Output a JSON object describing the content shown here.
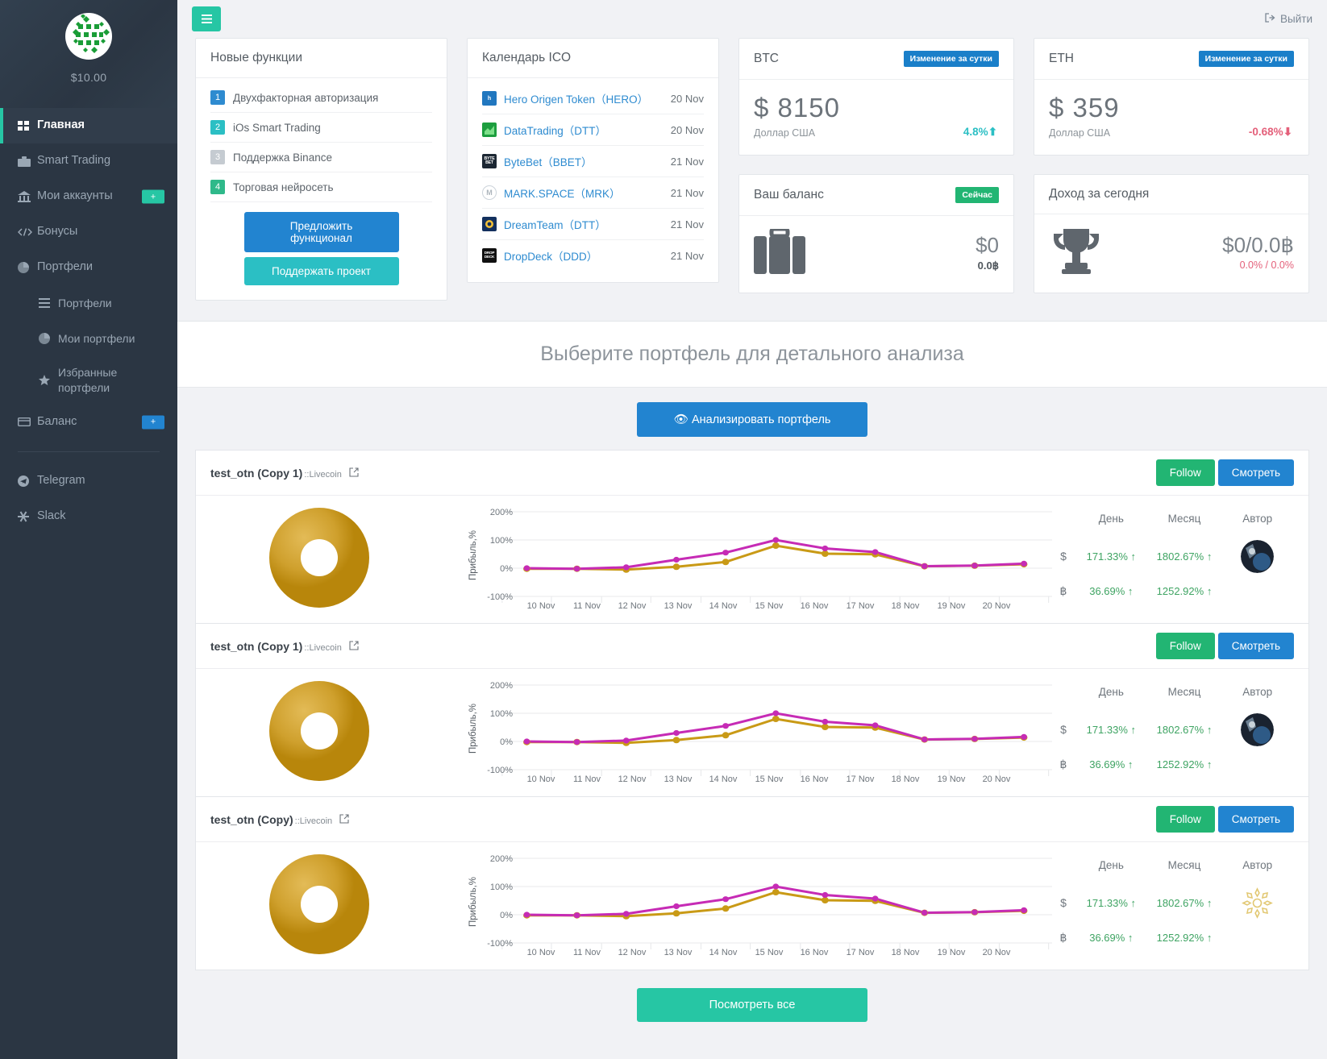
{
  "sidebar": {
    "balance": "$10.00",
    "logo_icon": "globe-grid-icon",
    "items": [
      {
        "label": "Главная",
        "icon": "dashboard-icon",
        "active": true
      },
      {
        "label": "Smart Trading",
        "icon": "briefcase-icon",
        "active": false
      },
      {
        "label": "Мои аккаунты",
        "icon": "bank-icon",
        "badge": "+",
        "badge_color": "#26c6a4"
      },
      {
        "label": "Бонусы",
        "icon": "code-icon"
      },
      {
        "label": "Портфели",
        "icon": "pie-chart-icon"
      }
    ],
    "sub_items": [
      {
        "label": "Портфели",
        "icon": "list-icon"
      },
      {
        "label": "Мои портфели",
        "icon": "pie-chart-icon"
      },
      {
        "label": "Избранные портфели",
        "icon": "star-icon"
      }
    ],
    "balance_item": {
      "label": "Баланс",
      "icon": "card-icon",
      "badge": "+",
      "badge_color": "#2284d0"
    },
    "social": [
      {
        "label": "Telegram",
        "icon": "telegram-icon"
      },
      {
        "label": "Slack",
        "icon": "slack-icon"
      }
    ]
  },
  "topbar": {
    "menu_icon": "hamburger-icon",
    "logout_label": "Выйти",
    "logout_icon": "logout-icon"
  },
  "features_card": {
    "title": "Новые функции",
    "items": [
      {
        "num": "1",
        "label": "Двухфакторная авторизация"
      },
      {
        "num": "2",
        "label": "iOs Smart Trading"
      },
      {
        "num": "3",
        "label": "Поддержка Binance"
      },
      {
        "num": "4",
        "label": "Торговая нейросеть"
      }
    ],
    "suggest_label": "Предложить функционал",
    "support_label": "Поддержать проект"
  },
  "ico_card": {
    "title": "Календарь ICO",
    "items": [
      {
        "name": "Hero Origen Token（HERO）",
        "date": "20 Nov",
        "logo": "hero-icon",
        "logo_bg": "#2177bf",
        "logo_text": "h"
      },
      {
        "name": "DataTrading（DTT）",
        "date": "20 Nov",
        "logo": "datatrading-icon",
        "logo_bg": "#1d9e3f",
        "logo_text": ""
      },
      {
        "name": "ByteBet（BBET）",
        "date": "21 Nov",
        "logo": "bytebet-icon",
        "logo_bg": "#1c2733",
        "logo_text": "BYTE BET"
      },
      {
        "name": "MARK.SPACE（MRK）",
        "date": "21 Nov",
        "logo": "markspace-icon",
        "logo_bg": "#ffffff",
        "logo_text": "M"
      },
      {
        "name": "DreamTeam（DTT）",
        "date": "21 Nov",
        "logo": "dreamteam-icon",
        "logo_bg": "#13305e",
        "logo_text": ""
      },
      {
        "name": "DropDeck（DDD）",
        "date": "21 Nov",
        "logo": "dropdeck-icon",
        "logo_bg": "#101010",
        "logo_text": "DROP DECK"
      }
    ]
  },
  "btc_card": {
    "title": "BTC",
    "badge": "Изменение за сутки",
    "value": "$ 8150",
    "currency": "Доллар США",
    "delta": "4.8%",
    "delta_dir": "up",
    "delta_color": "#2bbfc4"
  },
  "eth_card": {
    "title": "ETH",
    "badge": "Изменение за сутки",
    "value": "$ 359",
    "currency": "Доллар США",
    "delta": "-0.68%",
    "delta_dir": "down",
    "delta_color": "#e4607a"
  },
  "balance_card": {
    "title": "Ваш баланс",
    "badge": "Сейчас",
    "icon": "briefcase-icon",
    "main": "$0",
    "sub": "0.0฿"
  },
  "income_card": {
    "title": "Доход за сегодня",
    "icon": "trophy-icon",
    "main": "$0/0.0฿",
    "sub": "0.0%  /  0.0%"
  },
  "section": {
    "title": "Выберите портфель для детального анализа",
    "analyze_label": "Анализировать портфель",
    "analyze_icon": "eye-icon",
    "view_all_label": "Посмотреть все"
  },
  "portfolio_table": {
    "col_day": "День",
    "col_month": "Месяц",
    "col_author": "Автор",
    "follow_label": "Follow",
    "watch_label": "Смотреть",
    "external_icon": "external-link-icon"
  },
  "portfolios": [
    {
      "name": "test_otn (Copy 1)",
      "exchange": "::Livecoin",
      "usd_day": "171.33%",
      "usd_month": "1802.67%",
      "btc_day": "36.69%",
      "btc_month": "1252.92%",
      "usd_symbol": "$",
      "btc_symbol": "฿",
      "avatar_type": "photo"
    },
    {
      "name": "test_otn (Copy 1)",
      "exchange": "::Livecoin",
      "usd_day": "171.33%",
      "usd_month": "1802.67%",
      "btc_day": "36.69%",
      "btc_month": "1252.92%",
      "usd_symbol": "$",
      "btc_symbol": "฿",
      "avatar_type": "photo"
    },
    {
      "name": "test_otn (Copy)",
      "exchange": "::Livecoin",
      "usd_day": "171.33%",
      "usd_month": "1802.67%",
      "btc_day": "36.69%",
      "btc_month": "1252.92%",
      "usd_symbol": "$",
      "btc_symbol": "฿",
      "avatar_type": "ornament"
    }
  ],
  "chart_data": {
    "type": "line",
    "title": "",
    "xlabel": "",
    "ylabel": "Прибыль,%",
    "ylim": [
      -100,
      200
    ],
    "yticks": [
      200,
      100,
      0,
      -100
    ],
    "ytick_labels": [
      "200%",
      "100%",
      "0%",
      "-100%"
    ],
    "grid": true,
    "legend": "none",
    "x": [
      "10 Nov",
      "11 Nov",
      "12 Nov",
      "13 Nov",
      "14 Nov",
      "15 Nov",
      "16 Nov",
      "17 Nov",
      "18 Nov",
      "19 Nov",
      "20 Nov"
    ],
    "series": [
      {
        "name": "portfolio",
        "color": "#c62bb5",
        "values": [
          0,
          -2,
          3,
          30,
          55,
          100,
          70,
          57,
          7,
          9,
          16
        ]
      },
      {
        "name": "benchmark",
        "color": "#c99a16",
        "values": [
          0,
          -2,
          -5,
          5,
          22,
          80,
          52,
          55,
          12,
          9,
          14
        ]
      }
    ]
  }
}
